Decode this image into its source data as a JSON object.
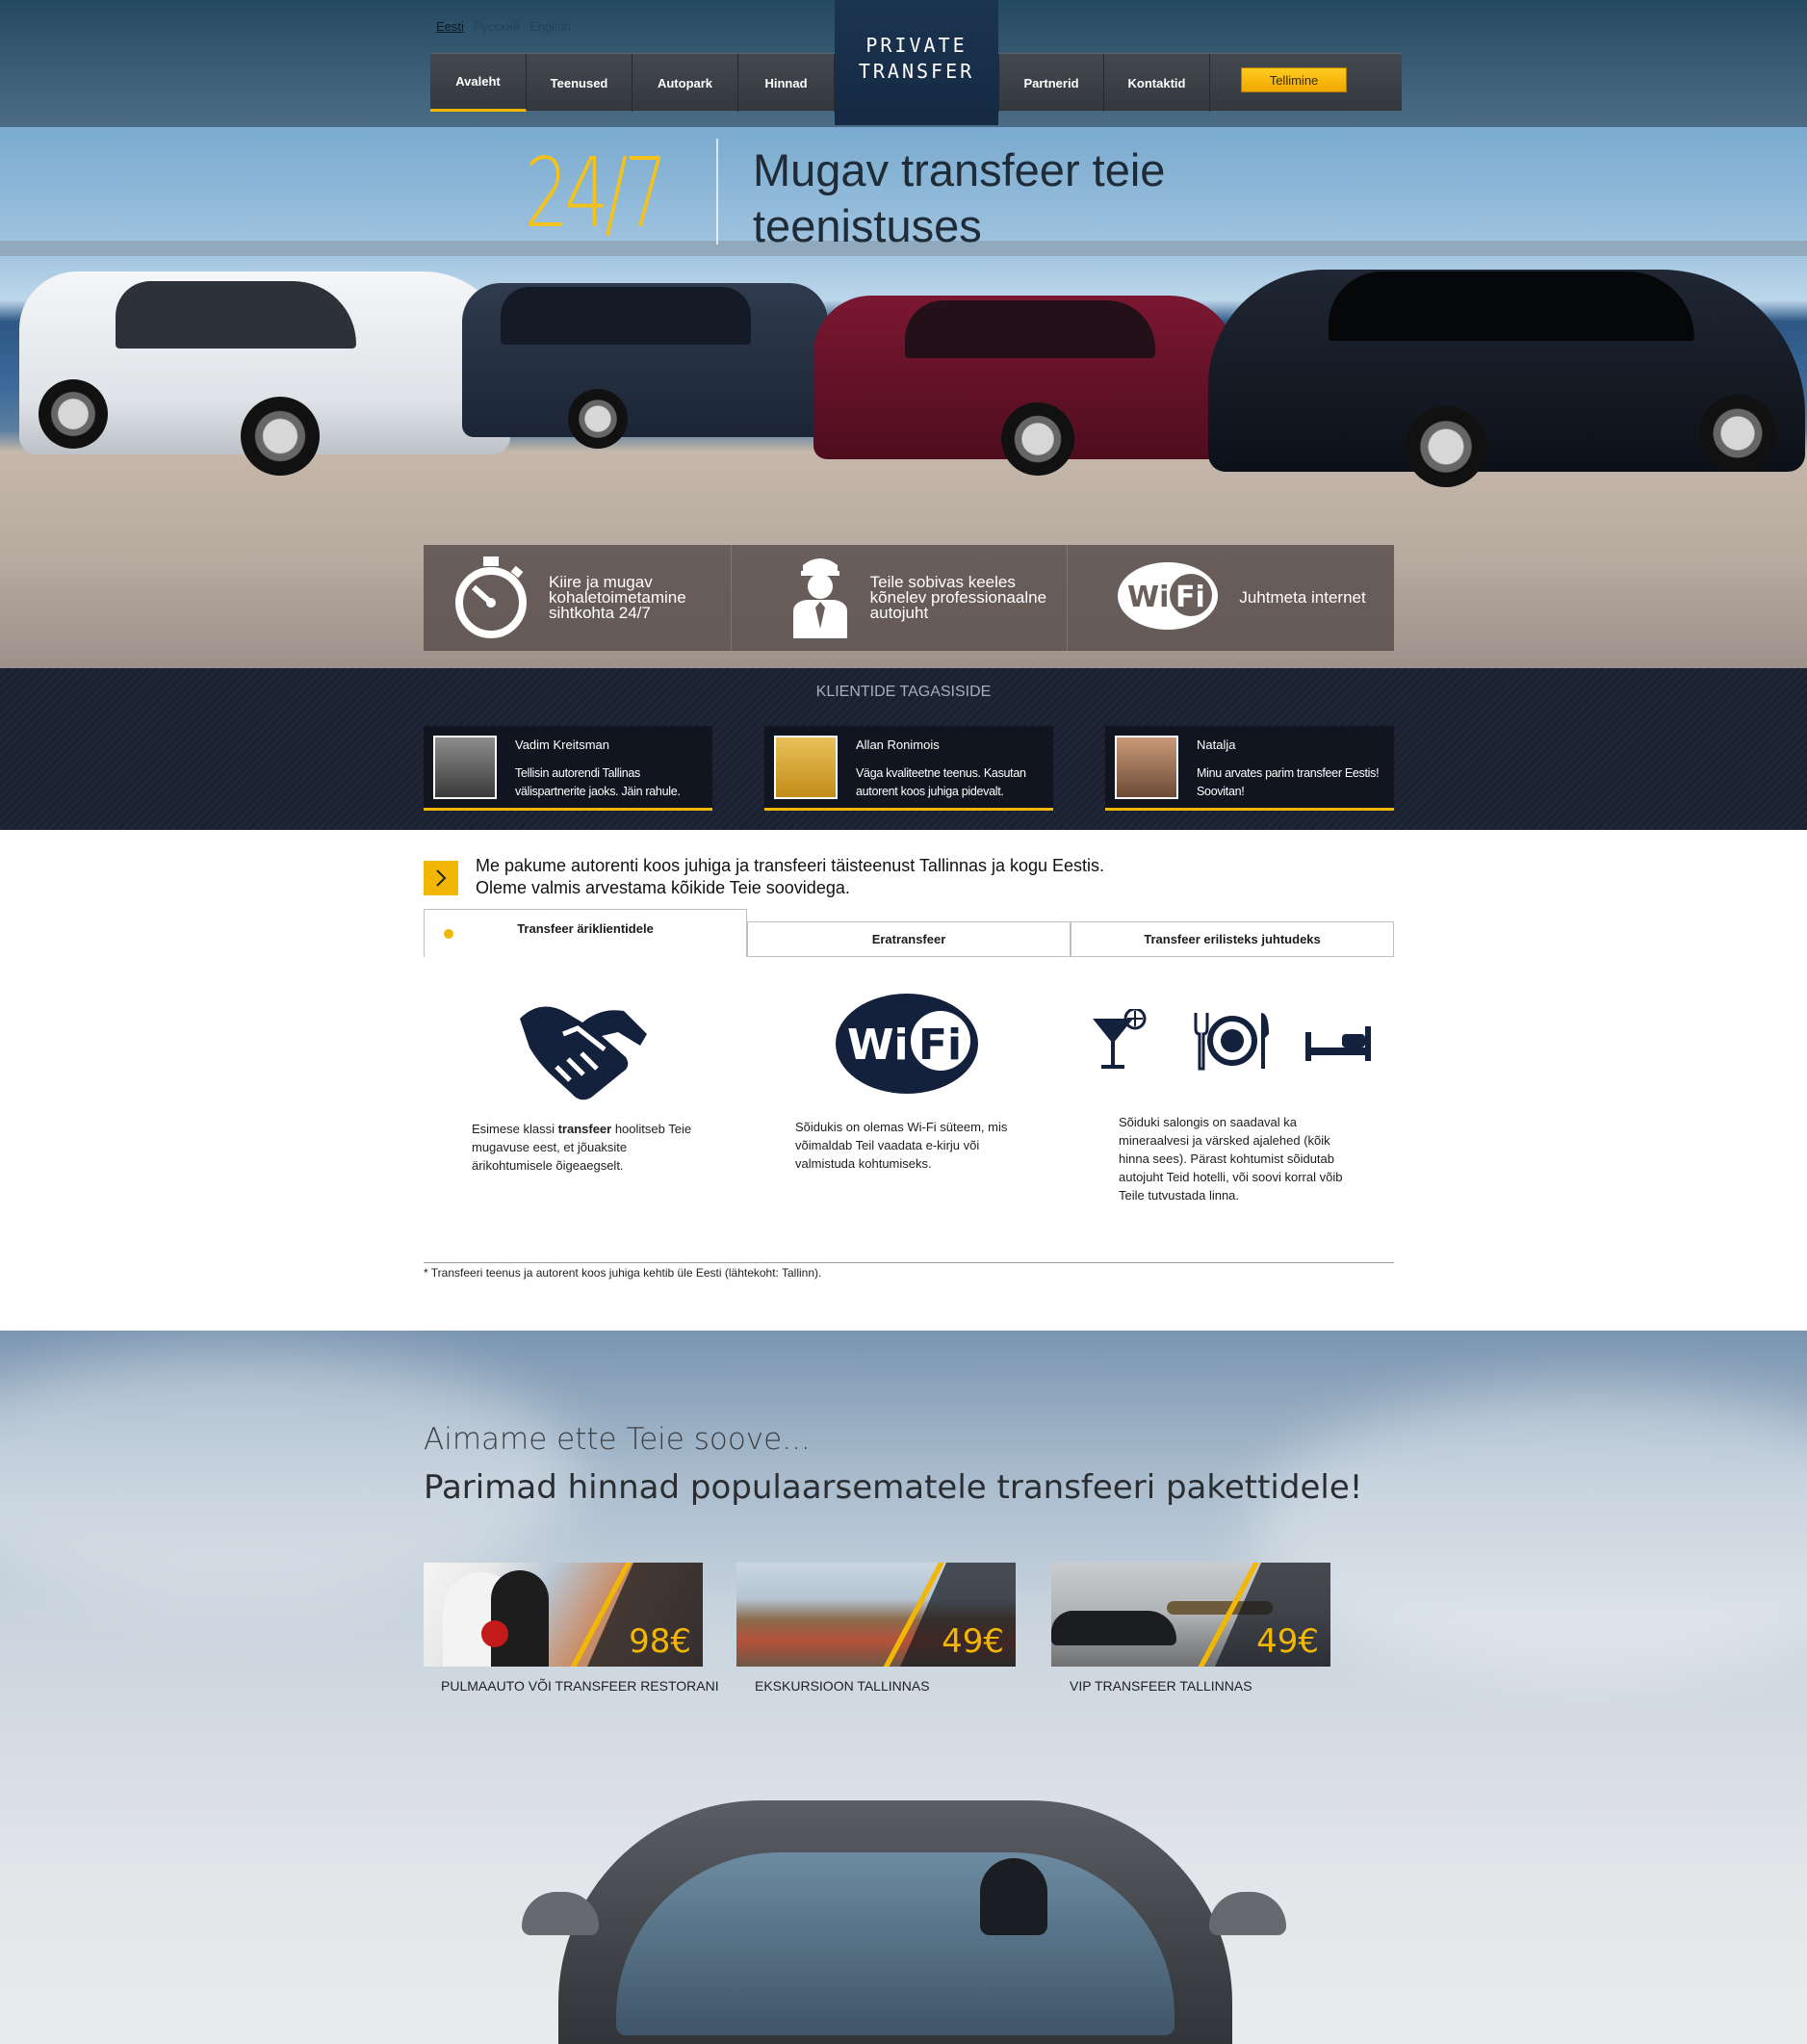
{
  "header": {
    "languages": [
      "Eesti",
      "Pусский",
      "English"
    ],
    "logo_line1": "PRIVATE",
    "logo_line2": "TRANSFER",
    "nav": [
      "Avaleht",
      "Teenused",
      "Autopark",
      "Hinnad",
      "Partnerid",
      "Kontaktid"
    ],
    "order_button": "Tellimine"
  },
  "hero": {
    "badge": "24/7",
    "title_line1": "Mugav transfeer teie",
    "title_line2": "teenistuses",
    "features": [
      {
        "icon": "stopwatch-icon",
        "text": "Kiire ja mugav kohaletoimetamine sihtkohta 24/7"
      },
      {
        "icon": "chauffeur-icon",
        "text": "Teile sobivas keeles kõnelev professionaalne autojuht"
      },
      {
        "icon": "wifi-icon",
        "text": "Juhtmeta internet"
      }
    ]
  },
  "testimonials": {
    "title": "KLIENTIDE TAGASISIDE",
    "items": [
      {
        "name": "Vadim Kreitsman",
        "text": "Tellisin autorendi Tallinas välispartnerite jaoks. Jäin rahule."
      },
      {
        "name": "Allan Ronimois",
        "text": "Väga kvaliteetne teenus. Kasutan autorent koos juhiga pidevalt."
      },
      {
        "name": "Natalja",
        "text": "Minu arvates parim transfeer Eestis! Soovitan!"
      }
    ]
  },
  "intro": {
    "line1": "Me pakume autorenti koos juhiga ja transfeeri täisteenust Tallinnas ja kogu Eestis.",
    "line2": "Oleme valmis arvestama kõikide Teie soovidega."
  },
  "tabs": [
    "Transfeer äriklientidele",
    "Eratransfeer",
    "Transfeer erilisteks juhtudeks"
  ],
  "columns": [
    {
      "icon": "handshake-icon",
      "text_before": "Esimese klassi ",
      "text_bold": "transfeer",
      "text_after": " hoolitseb Teie mugavuse eest, et jõuaksite ärikohtumisele õigeaegselt."
    },
    {
      "icon": "wifi-icon",
      "text": "Sõidukis on olemas Wi-Fi süteem, mis võimaldab Teil vaadata e-kirju või valmistuda kohtumiseks."
    },
    {
      "icons": [
        "cocktail-icon",
        "dining-icon",
        "bed-icon"
      ],
      "text": "Sõiduki salongis on saadaval ka mineraalvesi ja värsked ajalehed (kõik hinna sees). Pärast kohtumist sõidutab autojuht Teid hotelli, või soovi korral võib Teile tutvustada linna."
    }
  ],
  "footnote": "* Transfeeri teenus ja autorent koos juhiga kehtib üle Eesti (lähtekoht: Tallinn).",
  "packages": {
    "subtitle": "Aimame ette Teie soove...",
    "title": "Parimad hinnad populaarsematele transfeeri pakettidele!",
    "items": [
      {
        "price": "98€",
        "label": "PULMAAUTO VÕI TRANSFEER RESTORANI"
      },
      {
        "price": "49€",
        "label": "EKSKURSIOON TALLINNAS"
      },
      {
        "price": "49€",
        "label": "VIP TRANSFEER TALLINNAS"
      }
    ]
  },
  "colors": {
    "accent": "#f2b705",
    "navy": "#152a43",
    "dark_icon": "#14213d"
  }
}
